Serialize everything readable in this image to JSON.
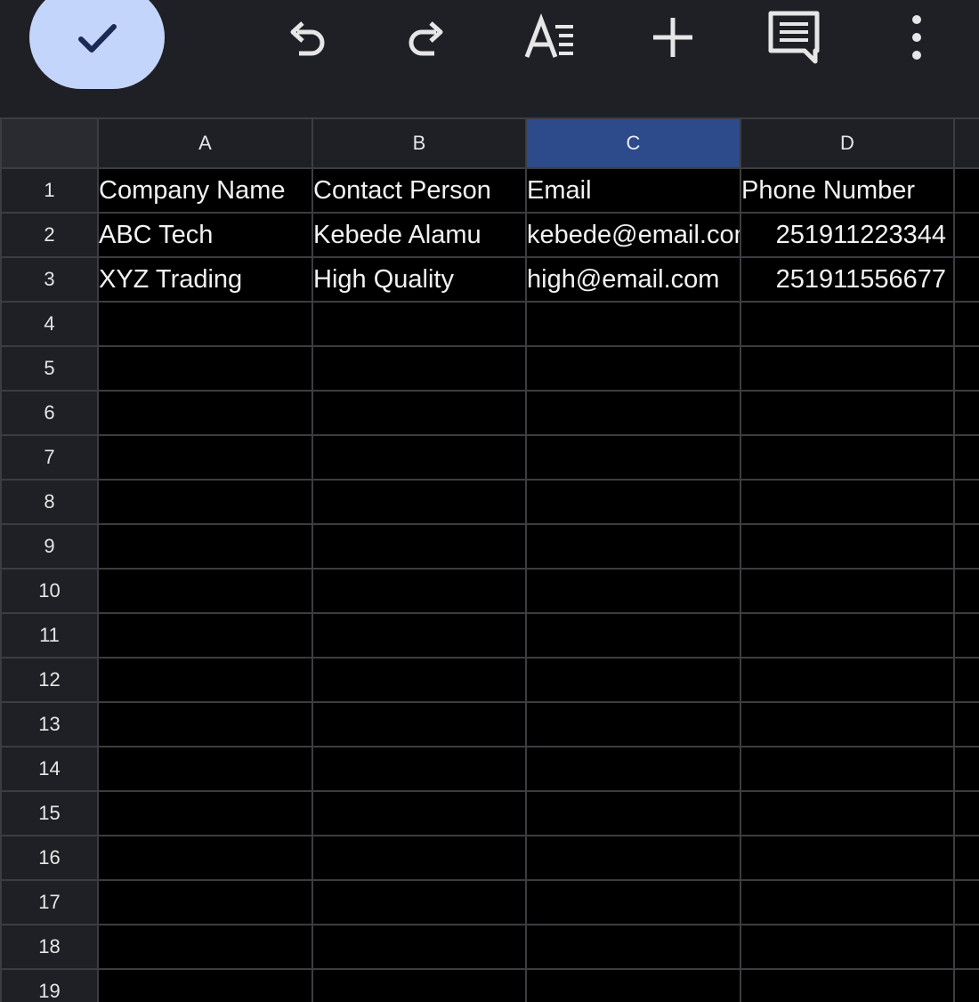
{
  "toolbar": {
    "done_icon": "check-icon",
    "undo_icon": "undo-icon",
    "redo_icon": "redo-icon",
    "format_icon": "text-format-icon",
    "insert_icon": "plus-icon",
    "comment_icon": "comment-icon",
    "more_icon": "more-vertical-icon"
  },
  "colors": {
    "toolbar_bg": "#1f2025",
    "done_button": "#c4d5fb",
    "selected_column_header": "#2d4a8a",
    "grid_line": "#3c3d41",
    "cell_bg": "#000000"
  },
  "sheet": {
    "selected_column": "C",
    "columns": [
      "A",
      "B",
      "C",
      "D"
    ],
    "row_numbers": [
      "1",
      "2",
      "3",
      "4",
      "5",
      "6",
      "7",
      "8",
      "9",
      "10",
      "11",
      "12",
      "13",
      "14",
      "15",
      "16",
      "17",
      "18",
      "19"
    ],
    "rows": [
      [
        "Company Name",
        "Contact Person",
        "Email",
        "Phone Number"
      ],
      [
        "ABC Tech",
        "Kebede Alamu",
        "kebede@email.com",
        "251911223344"
      ],
      [
        "XYZ Trading",
        "High Quality",
        "high@email.com",
        "251911556677"
      ]
    ]
  }
}
